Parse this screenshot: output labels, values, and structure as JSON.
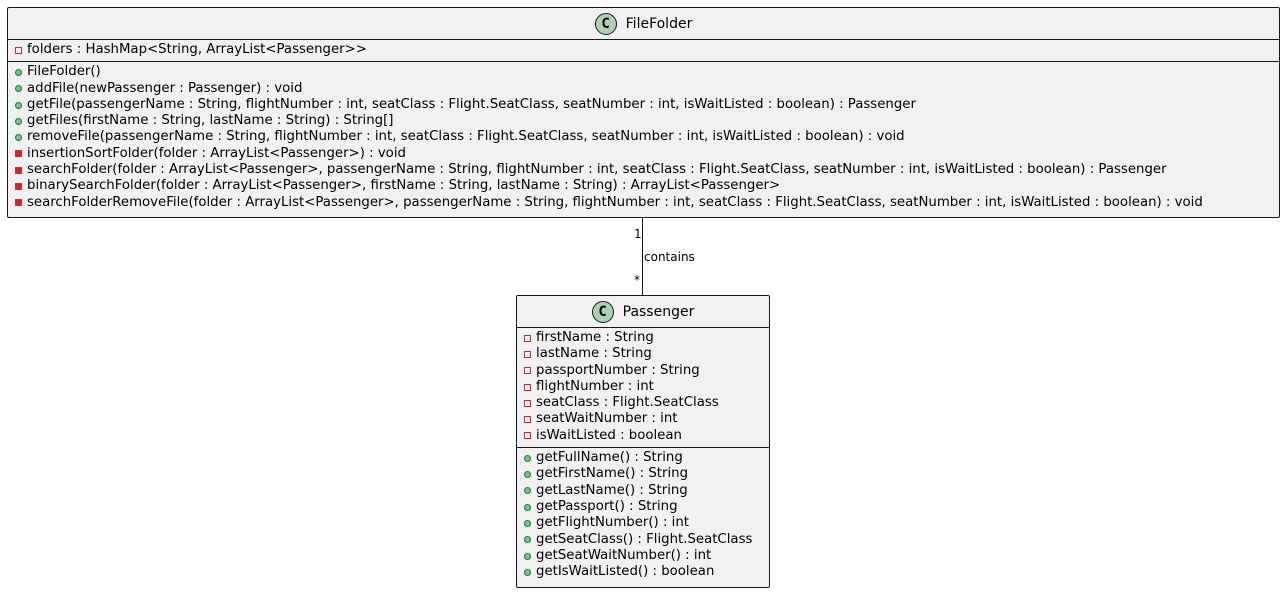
{
  "diagram": {
    "classes": [
      {
        "name": "FileFolder",
        "stereotype_icon": "C",
        "fields": [
          {
            "visibility": "private",
            "style": "hollow",
            "text": "folders : HashMap<String, ArrayList<Passenger>>"
          }
        ],
        "methods": [
          {
            "visibility": "public",
            "text": "FileFolder()"
          },
          {
            "visibility": "public",
            "text": "addFile(newPassenger : Passenger) : void"
          },
          {
            "visibility": "public",
            "text": "getFile(passengerName : String, flightNumber : int, seatClass : Flight.SeatClass, seatNumber : int, isWaitListed : boolean) : Passenger"
          },
          {
            "visibility": "public",
            "text": "getFiles(firstName : String, lastName : String) : String[]"
          },
          {
            "visibility": "public",
            "text": "removeFile(passengerName : String, flightNumber : int, seatClass : Flight.SeatClass, seatNumber : int, isWaitListed : boolean) : void"
          },
          {
            "visibility": "private",
            "text": "insertionSortFolder(folder : ArrayList<Passenger>) : void"
          },
          {
            "visibility": "private",
            "text": "searchFolder(folder : ArrayList<Passenger>, passengerName : String, flightNumber : int, seatClass : Flight.SeatClass, seatNumber : int, isWaitListed : boolean) : Passenger"
          },
          {
            "visibility": "private",
            "text": "binarySearchFolder(folder : ArrayList<Passenger>, firstName : String, lastName : String) : ArrayList<Passenger>"
          },
          {
            "visibility": "private",
            "text": "searchFolderRemoveFile(folder : ArrayList<Passenger>, passengerName : String, flightNumber : int, seatClass : Flight.SeatClass, seatNumber : int, isWaitListed : boolean) : void"
          }
        ]
      },
      {
        "name": "Passenger",
        "stereotype_icon": "C",
        "fields": [
          {
            "visibility": "private",
            "style": "hollow",
            "text": "firstName : String"
          },
          {
            "visibility": "private",
            "style": "hollow",
            "text": "lastName : String"
          },
          {
            "visibility": "private",
            "style": "hollow",
            "text": "passportNumber : String"
          },
          {
            "visibility": "private",
            "style": "hollow",
            "text": "flightNumber : int"
          },
          {
            "visibility": "private",
            "style": "hollow",
            "text": "seatClass : Flight.SeatClass"
          },
          {
            "visibility": "private",
            "style": "hollow",
            "text": "seatWaitNumber : int"
          },
          {
            "visibility": "private",
            "style": "hollow",
            "text": "isWaitListed : boolean"
          }
        ],
        "methods": [
          {
            "visibility": "public",
            "text": "getFullName() : String"
          },
          {
            "visibility": "public",
            "text": "getFirstName() : String"
          },
          {
            "visibility": "public",
            "text": "getLastName() : String"
          },
          {
            "visibility": "public",
            "text": "getPassport() : String"
          },
          {
            "visibility": "public",
            "text": "getFlightNumber() : int"
          },
          {
            "visibility": "public",
            "text": "getSeatClass() : Flight.SeatClass"
          },
          {
            "visibility": "public",
            "text": "getSeatWaitNumber() : int"
          },
          {
            "visibility": "public",
            "text": "getIsWaitListed() : boolean"
          }
        ]
      }
    ],
    "association": {
      "from": "FileFolder",
      "to": "Passenger",
      "label": "contains",
      "from_multiplicity": "1",
      "to_multiplicity": "*"
    },
    "colors": {
      "class_fill": "#f1f1f1",
      "border": "#181818",
      "class_icon": "#add1b2",
      "private_marker": "#c82930",
      "public_marker": "#84be84"
    }
  }
}
